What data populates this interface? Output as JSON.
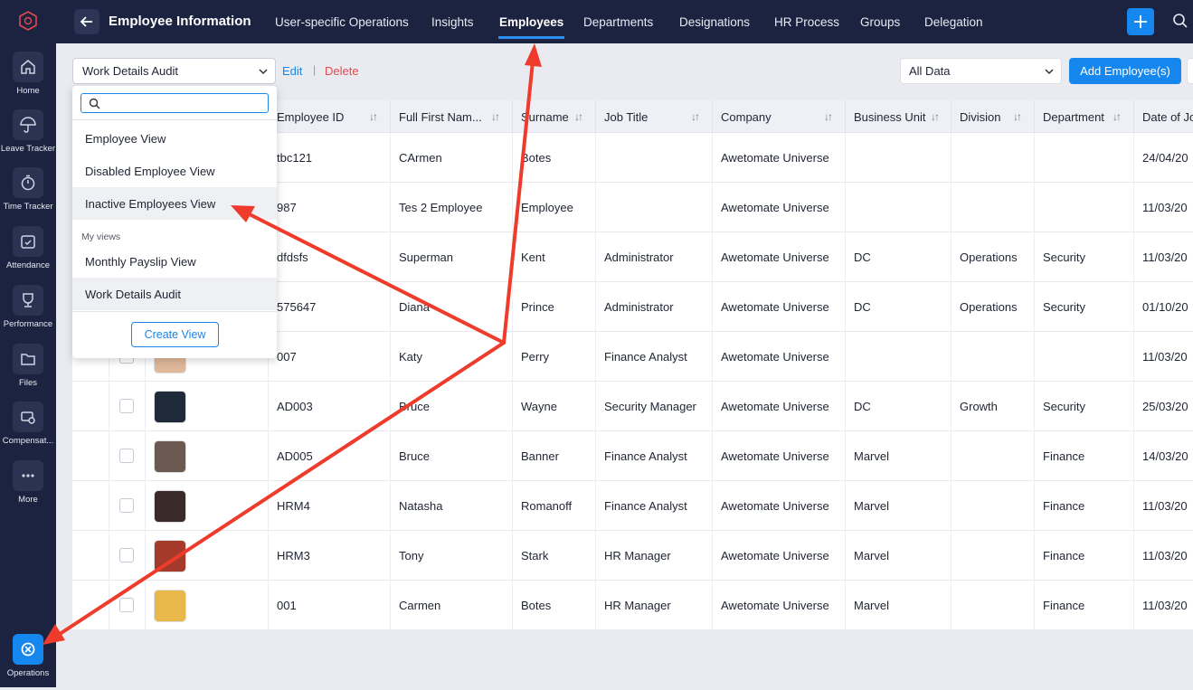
{
  "sidebar": {
    "items": [
      {
        "label": "Home",
        "icon": "home-icon"
      },
      {
        "label": "Leave Tracker",
        "icon": "umbrella-icon"
      },
      {
        "label": "Time Tracker",
        "icon": "stopwatch-icon"
      },
      {
        "label": "Attendance",
        "icon": "calendar-check-icon"
      },
      {
        "label": "Performance",
        "icon": "trophy-icon"
      },
      {
        "label": "Files",
        "icon": "folder-icon"
      },
      {
        "label": "Compensat...",
        "icon": "money-gear-icon"
      },
      {
        "label": "More",
        "icon": "more-dots-icon"
      }
    ],
    "active": {
      "label": "Operations",
      "icon": "operations-icon"
    }
  },
  "header": {
    "title": "Employee Information",
    "tabs": [
      "User-specific Operations",
      "Insights",
      "Employees",
      "Departments",
      "Designations",
      "HR Process",
      "Groups",
      "Delegation"
    ],
    "active_tab": "Employees"
  },
  "toolbar": {
    "view_selected": "Work Details Audit",
    "edit_label": "Edit",
    "separator": "|",
    "delete_label": "Delete",
    "data_filter": "All Data",
    "add_label": "Add Employee(s)"
  },
  "dropdown": {
    "search_placeholder": "",
    "items": [
      "Employee View",
      "Disabled Employee View",
      "Inactive Employees View"
    ],
    "group_label": "My views",
    "my_views": [
      "Monthly Payslip View",
      "Work Details Audit"
    ],
    "create_label": "Create View"
  },
  "table": {
    "columns": [
      "Employee ID",
      "Full First Nam...",
      "Surname",
      "Job Title",
      "Company",
      "Business Unit",
      "Division",
      "Department",
      "Date of Jo"
    ],
    "rows": [
      [
        "tbc121",
        "CArmen",
        "Botes",
        "",
        "Awetomate Universe",
        "",
        "",
        "",
        "24/04/20"
      ],
      [
        "987",
        "Tes 2 Employee",
        "Employee",
        "",
        "Awetomate Universe",
        "",
        "",
        "",
        "11/03/20"
      ],
      [
        "dfdsfs",
        "Superman",
        "Kent",
        "Administrator",
        "Awetomate Universe",
        "DC",
        "Operations",
        "Security",
        "11/03/20"
      ],
      [
        "575647",
        "Diana",
        "Prince",
        "Administrator",
        "Awetomate Universe",
        "DC",
        "Operations",
        "Security",
        "01/10/20"
      ],
      [
        "007",
        "Katy",
        "Perry",
        "Finance Analyst",
        "Awetomate Universe",
        "",
        "",
        "",
        "11/03/20"
      ],
      [
        "AD003",
        "Bruce",
        "Wayne",
        "Security Manager",
        "Awetomate Universe",
        "DC",
        "Growth",
        "Security",
        "25/03/20"
      ],
      [
        "AD005",
        "Bruce",
        "Banner",
        "Finance Analyst",
        "Awetomate Universe",
        "Marvel",
        "",
        "Finance",
        "14/03/20"
      ],
      [
        "HRM4",
        "Natasha",
        "Romanoff",
        "Finance Analyst",
        "Awetomate Universe",
        "Marvel",
        "",
        "Finance",
        "11/03/20"
      ],
      [
        "HRM3",
        "Tony",
        "Stark",
        "HR Manager",
        "Awetomate Universe",
        "Marvel",
        "",
        "Finance",
        "11/03/20"
      ],
      [
        "001",
        "Carmen",
        "Botes",
        "HR Manager",
        "Awetomate Universe",
        "Marvel",
        "",
        "Finance",
        "11/03/20"
      ]
    ]
  },
  "colors": {
    "accent": "#1687ee",
    "sidebar": "#1c2340",
    "annotation": "#ee3b2b",
    "delete": "#e5484d"
  }
}
